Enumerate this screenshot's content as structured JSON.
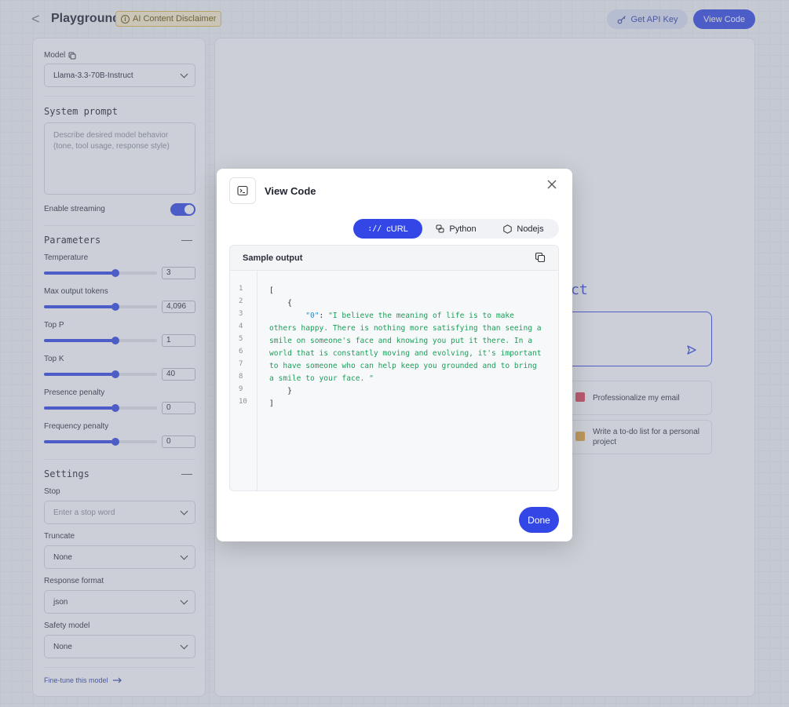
{
  "header": {
    "back_glyph": "<",
    "title": "Playground",
    "disclaimer": "AI Content Disclaimer",
    "get_api_key": "Get API Key",
    "view_code": "View Code"
  },
  "sidebar": {
    "model_label": "Model",
    "model_value": "Llama-3.3-70B-Instruct",
    "system_prompt_heading": "System prompt",
    "system_prompt_placeholder": "Describe desired model behavior (tone, tool usage, response style)",
    "enable_streaming_label": "Enable streaming",
    "enable_streaming_on": true,
    "parameters_heading": "Parameters",
    "parameters": [
      {
        "label": "Temperature",
        "value": "3",
        "fraction": 0.63
      },
      {
        "label": "Max output tokens",
        "value": "4,096",
        "fraction": 0.63
      },
      {
        "label": "Top P",
        "value": "1",
        "fraction": 0.63
      },
      {
        "label": "Top K",
        "value": "40",
        "fraction": 0.63
      },
      {
        "label": "Presence penalty",
        "value": "0",
        "fraction": 0.63
      },
      {
        "label": "Frequency penalty",
        "value": "0",
        "fraction": 0.63
      }
    ],
    "settings_heading": "Settings",
    "stop_label": "Stop",
    "stop_placeholder": "Enter a stop word",
    "truncate_label": "Truncate",
    "truncate_value": "None",
    "response_format_label": "Response format",
    "response_format_value": "json",
    "safety_model_label": "Safety model",
    "safety_model_value": "None",
    "fine_tune_link": "Fine-tune this model",
    "collapse_glyph": "—"
  },
  "main": {
    "heading_fragment": "ct",
    "suggestions": [
      {
        "label": "Professionalize my email",
        "color": "#e0435a"
      },
      {
        "label": "Write a to-do list for a personal project",
        "color": "#e6a53a"
      }
    ]
  },
  "modal": {
    "title": "View Code",
    "tabs": [
      {
        "label": "cURL",
        "icon": "curl-icon",
        "active": true
      },
      {
        "label": "Python",
        "icon": "python-icon",
        "active": false
      },
      {
        "label": "Nodejs",
        "icon": "nodejs-icon",
        "active": false
      }
    ],
    "code_panel_title": "Sample output",
    "line_numbers": [
      "1",
      "2",
      "3",
      "4",
      "5",
      "6",
      "7",
      "8",
      "9",
      "10"
    ],
    "code_lines": [
      {
        "text": "["
      },
      {
        "text": "    {"
      },
      {
        "key": "        \"0\"",
        "sep": ": ",
        "str": "\"I believe the meaning of life is to make"
      },
      {
        "str": "others happy. There is nothing more satisfying than seeing a"
      },
      {
        "str": "smile on someone's face and knowing you put it there. In a"
      },
      {
        "str": "world that is constantly moving and evolving, it's important"
      },
      {
        "str": "to have someone who can help keep you grounded and to bring"
      },
      {
        "str": "a smile to your face. \""
      },
      {
        "text": "    }"
      },
      {
        "text": "]"
      }
    ],
    "done_label": "Done"
  },
  "colors": {
    "accent": "#3347e6",
    "string": "#1e9e5a",
    "key": "#1f8fd6"
  }
}
